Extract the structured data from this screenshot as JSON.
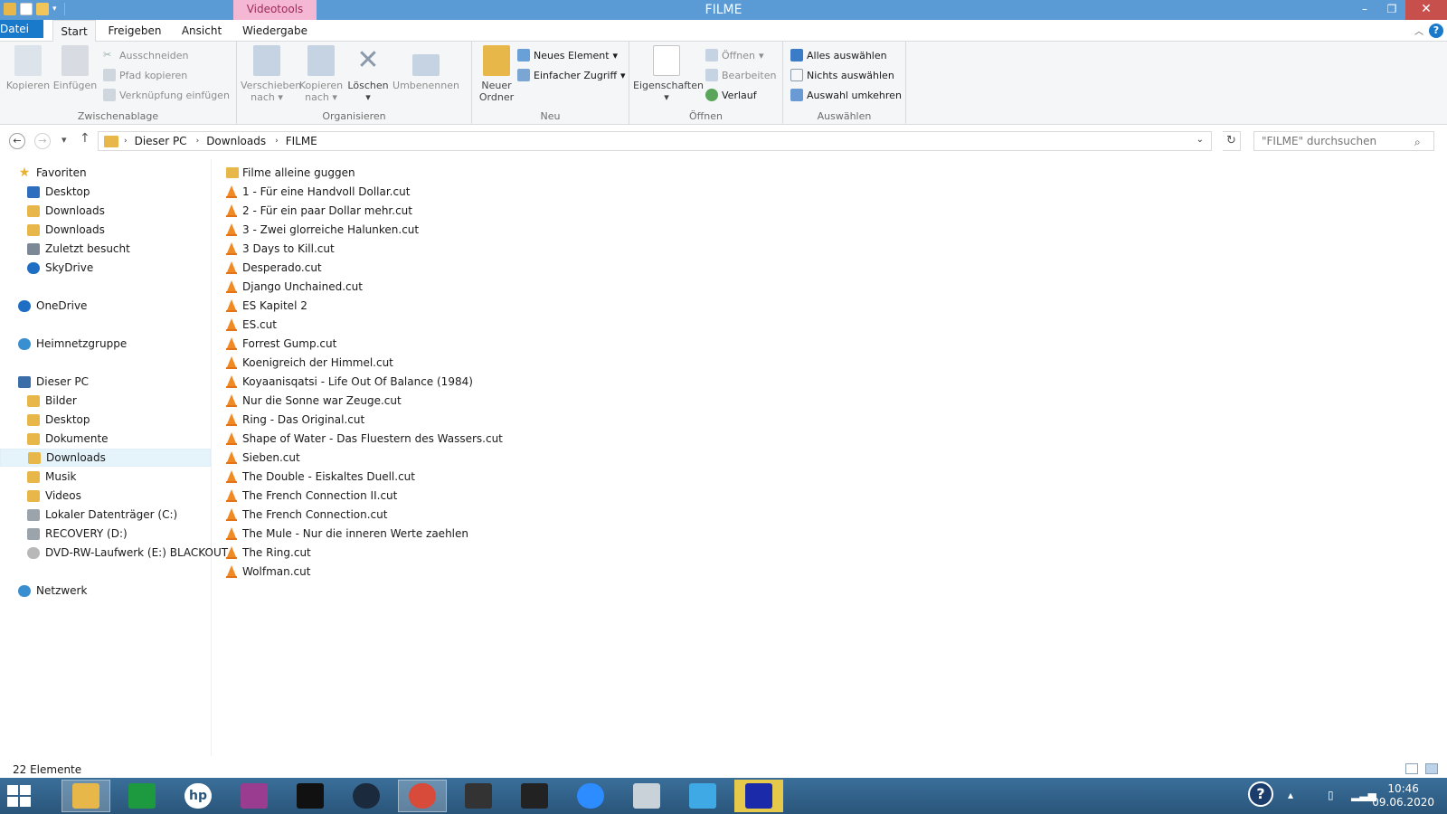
{
  "window": {
    "title": "FILME",
    "context_tab_header": "Videotools"
  },
  "ribbon_tabs": {
    "file": "Datei",
    "start": "Start",
    "share": "Freigeben",
    "view": "Ansicht",
    "playback": "Wiedergabe"
  },
  "ribbon": {
    "clipboard": {
      "label": "Zwischenablage",
      "copy": "Kopieren",
      "paste": "Einfügen",
      "cut": "Ausschneiden",
      "copy_path": "Pfad kopieren",
      "paste_shortcut": "Verknüpfung einfügen"
    },
    "organize": {
      "label": "Organisieren",
      "move_to": "Verschieben",
      "move_to_2": "nach",
      "copy_to": "Kopieren",
      "copy_to_2": "nach",
      "delete": "Löschen",
      "rename": "Umbenennen"
    },
    "new": {
      "label": "Neu",
      "new_folder": "Neuer",
      "new_folder_2": "Ordner",
      "new_item": "Neues Element",
      "easy_access": "Einfacher Zugriff"
    },
    "open": {
      "label": "Öffnen",
      "properties": "Eigenschaften",
      "open": "Öffnen",
      "edit": "Bearbeiten",
      "history": "Verlauf"
    },
    "select": {
      "label": "Auswählen",
      "select_all": "Alles auswählen",
      "select_none": "Nichts auswählen",
      "invert": "Auswahl umkehren"
    }
  },
  "address": {
    "crumbs": [
      "Dieser PC",
      "Downloads",
      "FILME"
    ],
    "search_placeholder": "\"FILME\" durchsuchen"
  },
  "sidebar": {
    "favorites": "Favoriten",
    "fav_items": [
      "Desktop",
      "Downloads",
      "Downloads",
      "Zuletzt besucht",
      "SkyDrive"
    ],
    "onedrive": "OneDrive",
    "homegroup": "Heimnetzgruppe",
    "this_pc": "Dieser PC",
    "pc_items": [
      "Bilder",
      "Desktop",
      "Dokumente",
      "Downloads",
      "Musik",
      "Videos",
      "Lokaler Datenträger (C:)",
      "RECOVERY (D:)",
      "DVD-RW-Laufwerk (E:) BLACKOUT"
    ],
    "network": "Netzwerk"
  },
  "files": [
    "Filme alleine guggen",
    "1 - Für eine Handvoll Dollar.cut",
    "2 - Für ein paar Dollar mehr.cut",
    "3 - Zwei glorreiche Halunken.cut",
    "3 Days to Kill.cut",
    "Desperado.cut",
    "Django Unchained.cut",
    "ES Kapitel 2",
    "ES.cut",
    "Forrest Gump.cut",
    "Koenigreich der Himmel.cut",
    "Koyaanisqatsi - Life Out Of Balance (1984)",
    "Nur die Sonne war Zeuge.cut",
    "Ring - Das Original.cut",
    "Shape of Water - Das Fluestern des Wassers.cut",
    "Sieben.cut",
    "The Double - Eiskaltes Duell.cut",
    "The French Connection II.cut",
    "The French Connection.cut",
    "The Mule - Nur die inneren Werte zaehlen",
    "The Ring.cut",
    "Wolfman.cut"
  ],
  "status": {
    "count": "22 Elemente"
  },
  "taskbar": {
    "time": "10:46",
    "date": "09.06.2020"
  },
  "colors": {
    "titlebar": "#5b9bd5",
    "file_tab": "#1979ca",
    "context_tab": "#f5b8d4",
    "taskbar": "#2a557a"
  }
}
